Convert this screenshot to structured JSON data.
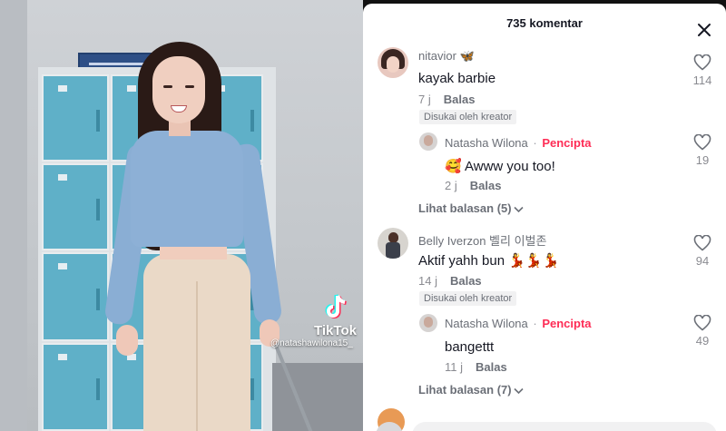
{
  "video": {
    "watermark_name": "TikTok",
    "watermark_user": "@natashawilona15_"
  },
  "panel": {
    "title": "735 komentar",
    "close_icon": "close-icon"
  },
  "comments": [
    {
      "username": "nitavior 🦋",
      "text": "kayak barbie",
      "time": "7 j",
      "reply_label": "Balas",
      "liked_by_creator": "Disukai oleh kreator",
      "likes": "114",
      "reply": {
        "username": "Natasha Wilona",
        "creator_label": "Pencipta",
        "text": "🥰 Awww you too!",
        "time": "2 j",
        "reply_label": "Balas",
        "likes": "19"
      },
      "view_replies": "Lihat balasan (5)"
    },
    {
      "username": "Belly Iverzon 벨리 이벌존",
      "text": "Aktif yahh bun 💃💃💃",
      "time": "14 j",
      "reply_label": "Balas",
      "liked_by_creator": "Disukai oleh kreator",
      "likes": "94",
      "reply": {
        "username": "Natasha Wilona",
        "creator_label": "Pencipta",
        "text": "bangettt",
        "time": "11 j",
        "reply_label": "Balas",
        "likes": "49"
      },
      "view_replies": "Lihat balasan (7)"
    }
  ],
  "colors": {
    "accent": "#fe2c55",
    "text": "#161823",
    "muted": "#8a8b91"
  }
}
